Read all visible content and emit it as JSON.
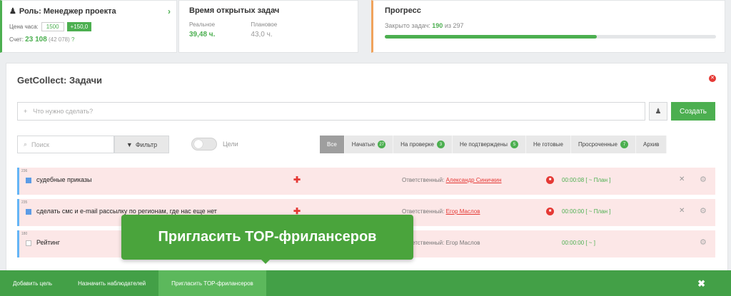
{
  "role_card": {
    "title": "Роль: Менеджер проекта",
    "arrow": "›",
    "rate_label": "Цена часа:",
    "rate_value": "1500",
    "rate_extra": "+150,0",
    "bill_label": "Счет:",
    "bill_value": "23 108",
    "bill_sub": "(42 078)",
    "bill_q": "?"
  },
  "time_card": {
    "title": "Время открытых задач",
    "real_label": "Реальное",
    "planned_label": "Плановое",
    "real_value": "39,48 ч.",
    "planned_value": "43,0 ч."
  },
  "progress_card": {
    "title": "Прогресс",
    "closed_label": "Закрыто задач:",
    "closed_value": "190",
    "of_label": "из",
    "total_value": "297",
    "progress_fraction": 0.64
  },
  "tasks": {
    "title": "GetCollect: Задачи",
    "new_task_placeholder": "Что нужно сделать?",
    "create_label": "Создать",
    "search_placeholder": "Поиск",
    "filter_label": "Фильтр",
    "goals_label": "Цели",
    "tabs": [
      {
        "label": "Все",
        "badge": ""
      },
      {
        "label": "Начатые",
        "badge": "27"
      },
      {
        "label": "На проверке",
        "badge": "3"
      },
      {
        "label": "Не подтверждены",
        "badge": "5"
      },
      {
        "label": "Не готовые",
        "badge": ""
      },
      {
        "label": "Просроченные",
        "badge": "7"
      },
      {
        "label": "Архив",
        "badge": ""
      }
    ],
    "rows": [
      {
        "num": "236",
        "name": "судебные приказы",
        "resp_label": "Ответственный:",
        "resp_name": "Александр Синичкин",
        "timer": "00:00:08 [ ~ План ]"
      },
      {
        "num": "235",
        "name": "сделать смс и e-mail рассылку по регионам, где нас еще нет",
        "resp_label": "Ответственный:",
        "resp_name": "Егор Маслов",
        "timer": "00:00:00 [ ~ План ]"
      },
      {
        "num": "180",
        "name": "Рейтинг",
        "resp_label": "Ответственный:",
        "resp_name": "Егор Маслов",
        "timer": "00:00:00 [ ~ ]"
      }
    ]
  },
  "tooltip": {
    "text": "Пригласить TOP-фрилансеров"
  },
  "bottom_bar": {
    "items": [
      "Добавить цель",
      "Назначить наблюдателей",
      "Пригласить TOP-фрилансеров"
    ],
    "close": "✖"
  },
  "icons": {
    "plus": "+",
    "user": "👤",
    "search": "⌕",
    "filter": "▼",
    "star": "✚",
    "close": "✕",
    "gear": "⚙",
    "stop": "■"
  }
}
